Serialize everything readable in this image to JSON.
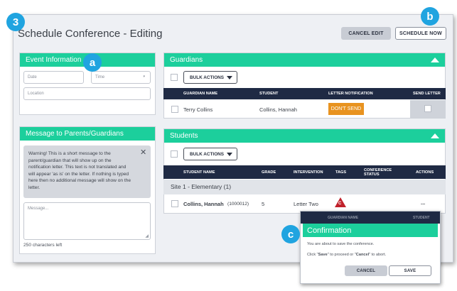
{
  "callouts": {
    "a": "a",
    "b": "b",
    "c": "c",
    "three": "3"
  },
  "page": {
    "title": "Schedule Conference - Editing"
  },
  "toolbar": {
    "cancel_edit": "CANCEL EDIT",
    "schedule_now": "SCHEDULE NOW"
  },
  "event": {
    "header": "Event Information",
    "date_placeholder": "Date",
    "time_placeholder": "Time",
    "location_placeholder": "Location"
  },
  "message": {
    "header": "Message to Parents/Guardians",
    "warning": "Warning! This is a short message to the parent/guardian that will show up on the notification letter. This text is not translated and will appear 'as is' on the letter. If nothing is typed here then no additional message will show on the letter.",
    "placeholder": "Message...",
    "chars_left": "250 characters left"
  },
  "guardians": {
    "header": "Guardians",
    "bulk": "BULK ACTIONS",
    "columns": [
      "GUARDIAN NAME",
      "STUDENT",
      "LETTER NOTIFICATION",
      "SEND LETTER"
    ],
    "rows": [
      {
        "name": "Terry Collins",
        "student": "Collins, Hannah",
        "notification": "DON'T SEND"
      }
    ]
  },
  "students": {
    "header": "Students",
    "bulk": "BULK ACTIONS",
    "columns": [
      "STUDENT NAME",
      "GRADE",
      "INTERVENTION",
      "TAGS",
      "CONFERENCE STATUS",
      "ACTIONS"
    ],
    "group": "Site 1 - Elementary (1)",
    "rows": [
      {
        "name": "Collins, Hannah",
        "id": "(1000012)",
        "grade": "5",
        "intervention": "Letter Two",
        "tag": "C",
        "actions": "..."
      }
    ]
  },
  "modal": {
    "behind_labels": [
      "GUARDIAN NAME",
      "STUDENT"
    ],
    "title": "Confirmation",
    "line1": "You are about to save the conference.",
    "line2_pre": "Click \"",
    "line2_save": "Save",
    "line2_mid": "\" to proceed or \"",
    "line2_cancel": "Cancel",
    "line2_post": "\" to abort.",
    "cancel": "CANCEL",
    "save": "SAVE"
  },
  "colors": {
    "teal": "#1ccf9c",
    "navy": "#1f2a44",
    "callout": "#20a4e0",
    "orange": "#e89320",
    "tag_red": "#c0202a"
  }
}
